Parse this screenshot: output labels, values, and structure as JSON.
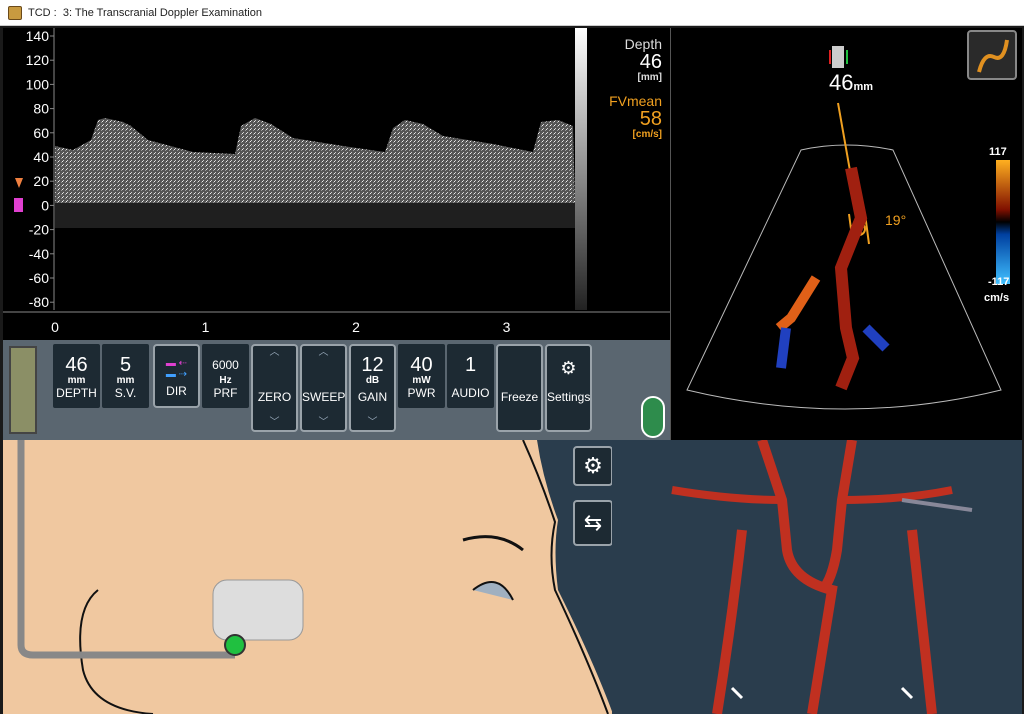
{
  "window": {
    "app_icon": "tcd-app-icon",
    "title": "TCD :  3: The Transcranial Doppler Examination"
  },
  "spectrum": {
    "y_ticks": [
      "140",
      "120",
      "100",
      "80",
      "60",
      "40",
      "20",
      "0",
      "-20",
      "-40",
      "-60",
      "-80"
    ],
    "x_ticks": [
      "0",
      "1",
      "2",
      "3"
    ],
    "depth_label": "Depth",
    "depth_value": "46",
    "depth_unit": "[mm]",
    "fvmean_label": "FVmean",
    "fvmean_value": "58",
    "fvmean_unit": "[cm/s]"
  },
  "ultrasound": {
    "depth_value": "46",
    "depth_unit": "mm",
    "angle": "19°",
    "scale_top": "117",
    "scale_bottom": "-117",
    "scale_unit": "cm/s"
  },
  "controls": [
    {
      "value": "46",
      "unit": "mm",
      "label": "DEPTH"
    },
    {
      "value": "5",
      "unit": "mm",
      "label": "S.V."
    },
    {
      "value": "",
      "unit": "",
      "label": "DIR"
    },
    {
      "value": "6000",
      "unit": "Hz",
      "label": "PRF"
    },
    {
      "value": "",
      "unit": "",
      "label": "ZERO"
    },
    {
      "value": "",
      "unit": "",
      "label": "SWEEP"
    },
    {
      "value": "12",
      "unit": "dB",
      "label": "GAIN"
    },
    {
      "value": "40",
      "unit": "mW",
      "label": "PWR"
    },
    {
      "value": "1",
      "unit": "",
      "label": "AUDIO"
    },
    {
      "value": "",
      "unit": "",
      "label": "Freeze"
    },
    {
      "value": "",
      "unit": "",
      "label": "Settings"
    }
  ],
  "colors": {
    "accent": "#f0a020",
    "green": "#2e8c4c",
    "panel": "#5a6670"
  }
}
